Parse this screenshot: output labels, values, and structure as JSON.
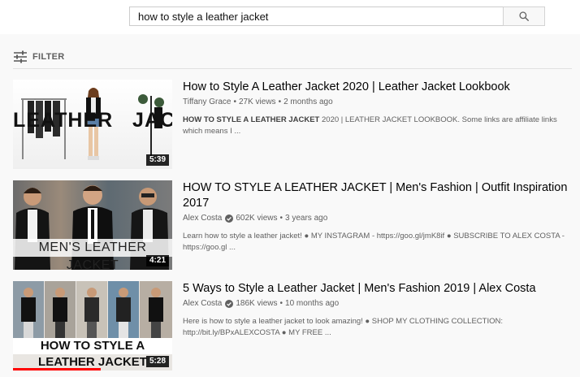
{
  "search": {
    "value": "how to style a leather jacket",
    "button_icon": "search-icon"
  },
  "filter": {
    "label": "FILTER",
    "icon": "filter-sliders-icon"
  },
  "results": [
    {
      "title": "How to Style A Leather Jacket 2020 | Leather Jacket Lookbook",
      "channel": "Tiffany Grace",
      "verified": false,
      "views": "27K views",
      "age": "2 months ago",
      "description_bold": "HOW TO STYLE A LEATHER JACKET",
      "description": " 2020 | LEATHER JACKET LOOKBOOK. Some links are affiliate links which means I ...",
      "duration": "5:39",
      "thumb_text_left": "LEATHER",
      "thumb_text_right": "JACKET"
    },
    {
      "title": "HOW TO STYLE A LEATHER JACKET | Men's Fashion | Outfit Inspiration 2017",
      "channel": "Alex Costa",
      "verified": true,
      "views": "602K views",
      "age": "3 years ago",
      "description_bold": "",
      "description": "Learn how to style a leather jacket! ● MY INSTAGRAM - https://goo.gl/jmK8if ● SUBSCRIBE TO ALEX COSTA - https://goo.gl ...",
      "duration": "4:21",
      "thumb_text": "MEN'S LEATHER JACKET"
    },
    {
      "title": "5 Ways to Style a Leather Jacket | Men's Fashion 2019 | Alex Costa",
      "channel": "Alex Costa",
      "verified": true,
      "views": "186K views",
      "age": "10 months ago",
      "description_bold": "",
      "description": "Here is how to style a leather jacket to look amazing! ● SHOP MY CLOTHING COLLECTION: http://bit.ly/BPxALEXCOSTA ● MY FREE ...",
      "duration": "5:28",
      "thumb_text": "HOW TO STYLE A LEATHER JACKET",
      "watch_progress": 0.55
    }
  ],
  "separator": "•",
  "colors": {
    "accent_red": "#ff0000",
    "text_secondary": "#606060",
    "background": "#f9f9f9"
  }
}
